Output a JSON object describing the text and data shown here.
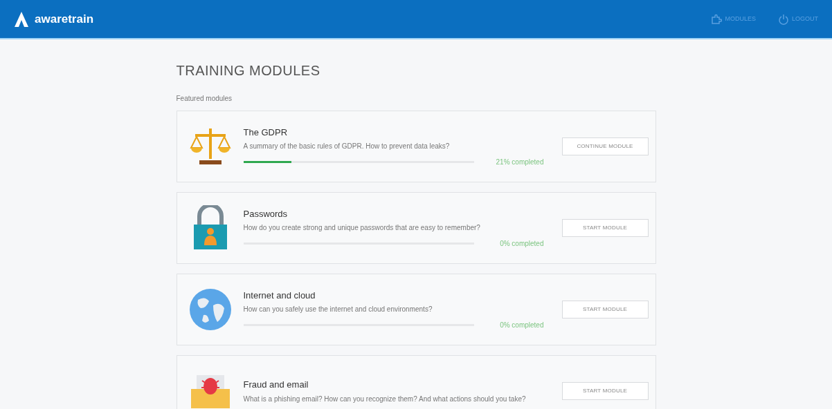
{
  "header": {
    "logo": "awaretrain",
    "nav": [
      {
        "kind": "modules",
        "label": "MODULES"
      },
      {
        "kind": "logout",
        "label": "LOGOUT"
      }
    ]
  },
  "title": "TRAINING MODULES",
  "section": "Featured modules",
  "modules": [
    {
      "kind": "scales",
      "title": "The GDPR",
      "description": "A summary of the basic rules of GDPR. How to prevent data leaks?",
      "level": 0.21,
      "progress_label": "21% completed",
      "button": "CONTINUE MODULE"
    },
    {
      "kind": "padlock",
      "title": "Passwords",
      "description": "How do you create strong and unique passwords that are easy to remember?",
      "level": 0,
      "progress_label": "0% completed",
      "button": "START MODULE"
    },
    {
      "kind": "globe",
      "title": "Internet and cloud",
      "description": "How can you safely use the internet and cloud environments?",
      "level": 0,
      "progress_label": "0% completed",
      "button": "START MODULE"
    },
    {
      "kind": "envelope",
      "title": "Fraud and email",
      "description": "What is a phishing email? How can you recognize them? And what actions should you take?",
      "button": "START MODULE"
    }
  ]
}
